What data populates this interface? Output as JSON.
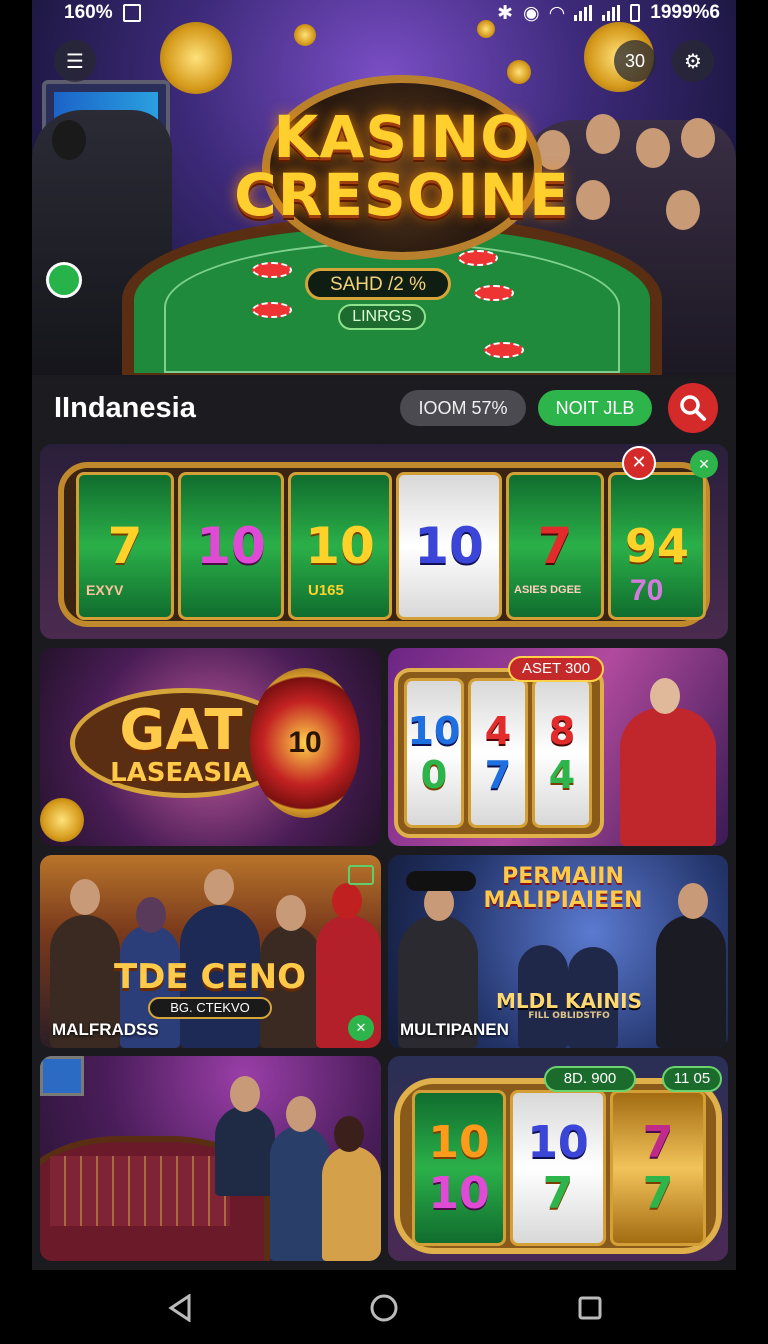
{
  "status_bar": {
    "left_text": "160%",
    "right_text": "1999%6"
  },
  "hero": {
    "notification_count": "30",
    "logo_line1": "KASINO",
    "logo_line2": "CRESOINE",
    "pill_primary": "SAHD /2 %",
    "pill_secondary": "LINRGS"
  },
  "header": {
    "title": "IIndanesia",
    "chip_gray": "IOOM 57%",
    "chip_green": "NOIT JLB"
  },
  "slot_banner": {
    "reels": [
      {
        "top": "7",
        "bottom": "EXYV"
      },
      {
        "top": "10",
        "bottom": ""
      },
      {
        "top": "10",
        "bottom": "U165"
      },
      {
        "top": "10",
        "bottom": ""
      },
      {
        "top": "7",
        "bottom": "ASIES DGEE"
      },
      {
        "top": "94",
        "bottom": "70"
      }
    ]
  },
  "tiles": [
    {
      "title_line1": "GAT",
      "title_line2": "LASEASIA",
      "wheel_number": "10"
    },
    {
      "badge": "ASET 300",
      "reels": [
        "10",
        "4",
        "8",
        "0",
        "7",
        "4"
      ]
    },
    {
      "headline": "TDE CENO",
      "subline": "BG. CTEKVO",
      "label": "MALFRADSS"
    },
    {
      "headline_line1": "PERMAIIN",
      "headline_line2": "MALIPIAIEEN",
      "subline": "MLDL KAINIS",
      "subline_small": "FILL OBLIDSTFO",
      "label": "MULTIPANEN"
    },
    {
      "scene": "roulette table"
    },
    {
      "badge_left": "8D. 900",
      "badge_right": "11 05",
      "reels": [
        "10",
        "10",
        "7"
      ],
      "reels_bottom": [
        "10",
        "7",
        "7"
      ]
    }
  ],
  "colors": {
    "accent_green": "#2db44a",
    "accent_red": "#d42a2a",
    "gold": "#ffcf2e"
  }
}
